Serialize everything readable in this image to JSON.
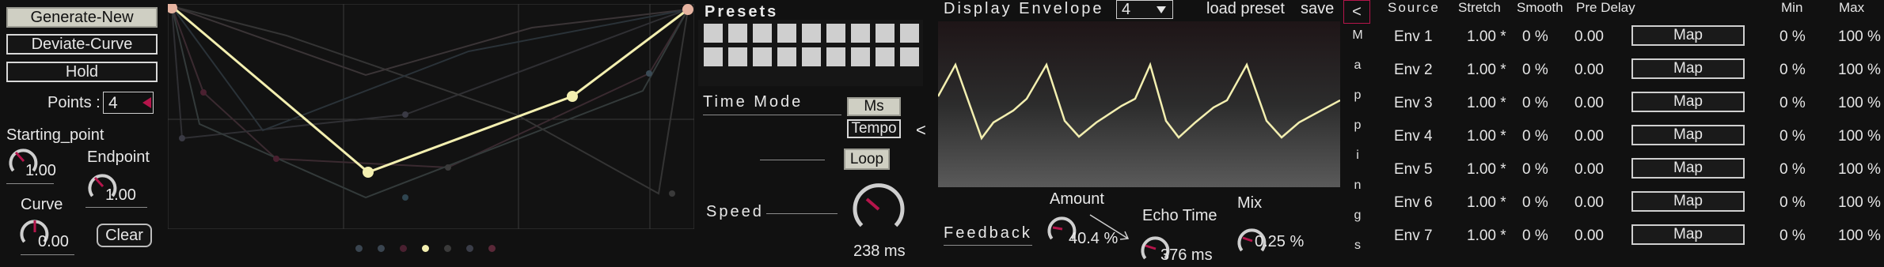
{
  "colors": {
    "background": "#111111",
    "accent": "#b5154b",
    "curve_active": "#f3efb0",
    "button_light": "#cfcfc3",
    "envelope_line": "#f3efb0"
  },
  "curve_panel": {
    "generate_new": "Generate-New",
    "deviate_curve": "Deviate-Curve",
    "hold": "Hold",
    "points_label": "Points :",
    "points_value": "4",
    "starting_point_label": "Starting_point",
    "starting_point_value": "1.00",
    "endpoint_label": "Endpoint",
    "endpoint_value": "1.00",
    "curve_label": "Curve",
    "curve_value": "0.00",
    "clear": "Clear",
    "active_curve": [
      [
        0,
        1.0
      ],
      [
        0.37,
        0.25
      ],
      [
        0.77,
        0.56
      ],
      [
        1.0,
        1.0
      ]
    ]
  },
  "presets": {
    "title": "Presets",
    "time_mode_label": "Time Mode",
    "ms": "Ms",
    "tempo": "Tempo",
    "loop": "Loop",
    "speed_label": "Speed",
    "speed_value": "238 ms",
    "collapse_icon": "<"
  },
  "envelope": {
    "title": "Display Envelope",
    "select_value": "4",
    "load_preset": "load preset",
    "save": "save",
    "feedback_label": "Feedback",
    "amount_label": "Amount",
    "amount_value": "40.4 %",
    "echo_time_label": "Echo Time",
    "echo_time_value": "376 ms",
    "mix_label": "Mix",
    "mix_value": "0.25 %"
  },
  "mapping": {
    "collapse_icon": "<",
    "vertical_label": [
      "M",
      "a",
      "p",
      "p",
      "i",
      "n",
      "g",
      "s"
    ],
    "headers": {
      "source": "Source",
      "stretch": "Stretch",
      "smooth": "Smooth",
      "pre_delay": "Pre Delay",
      "min": "Min",
      "max": "Max"
    },
    "rows": [
      {
        "source": "Env 1",
        "stretch": "1.00 *",
        "smooth": "0 %",
        "pre_delay": "0.00",
        "map": "Map",
        "min": "0 %",
        "max": "100 %"
      },
      {
        "source": "Env 2",
        "stretch": "1.00 *",
        "smooth": "0 %",
        "pre_delay": "0.00",
        "map": "Map",
        "min": "0 %",
        "max": "100 %"
      },
      {
        "source": "Env 3",
        "stretch": "1.00 *",
        "smooth": "0 %",
        "pre_delay": "0.00",
        "map": "Map",
        "min": "0 %",
        "max": "100 %"
      },
      {
        "source": "Env 4",
        "stretch": "1.00 *",
        "smooth": "0 %",
        "pre_delay": "0.00",
        "map": "Map",
        "min": "0 %",
        "max": "100 %"
      },
      {
        "source": "Env 5",
        "stretch": "1.00 *",
        "smooth": "0 %",
        "pre_delay": "0.00",
        "map": "Map",
        "min": "0 %",
        "max": "100 %"
      },
      {
        "source": "Env 6",
        "stretch": "1.00 *",
        "smooth": "0 %",
        "pre_delay": "0.00",
        "map": "Map",
        "min": "0 %",
        "max": "100 %"
      },
      {
        "source": "Env 7",
        "stretch": "1.00 *",
        "smooth": "0 %",
        "pre_delay": "0.00",
        "map": "Map",
        "min": "0 %",
        "max": "100 %"
      }
    ]
  }
}
